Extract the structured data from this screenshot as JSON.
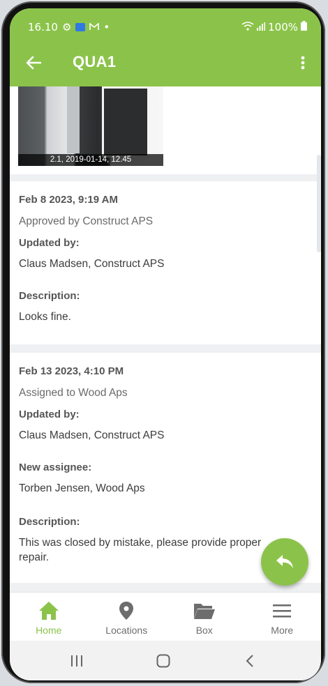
{
  "status_bar": {
    "time": "16.10",
    "battery": "100%"
  },
  "app_bar": {
    "title": "QUA1"
  },
  "photo": {
    "caption": "2.1, 2019-01-14, 12.45"
  },
  "history": [
    {
      "date": "Feb 8 2023, 9:19 AM",
      "status": "Approved by Construct APS",
      "updated_by_label": "Updated by:",
      "updated_by": "Claus Madsen, Construct APS",
      "description_label": "Description:",
      "description": "Looks fine."
    },
    {
      "date": "Feb 13 2023, 4:10 PM",
      "status": "Assigned to Wood Aps",
      "updated_by_label": "Updated by:",
      "updated_by": "Claus Madsen, Construct APS",
      "new_assignee_label": "New assignee:",
      "new_assignee": "Torben Jensen, Wood Aps",
      "description_label": "Description:",
      "description": "This was closed by mistake, please provide proper repair."
    }
  ],
  "bottom_nav": [
    {
      "label": "Home",
      "icon": "home-icon",
      "active": true
    },
    {
      "label": "Locations",
      "icon": "location-pin-icon",
      "active": false
    },
    {
      "label": "Box",
      "icon": "folder-icon",
      "active": false
    },
    {
      "label": "More",
      "icon": "hamburger-menu-icon",
      "active": false
    }
  ],
  "colors": {
    "accent": "#8bc34a",
    "text_dark": "#3c3c3c",
    "text_muted": "#6a6a6a"
  }
}
